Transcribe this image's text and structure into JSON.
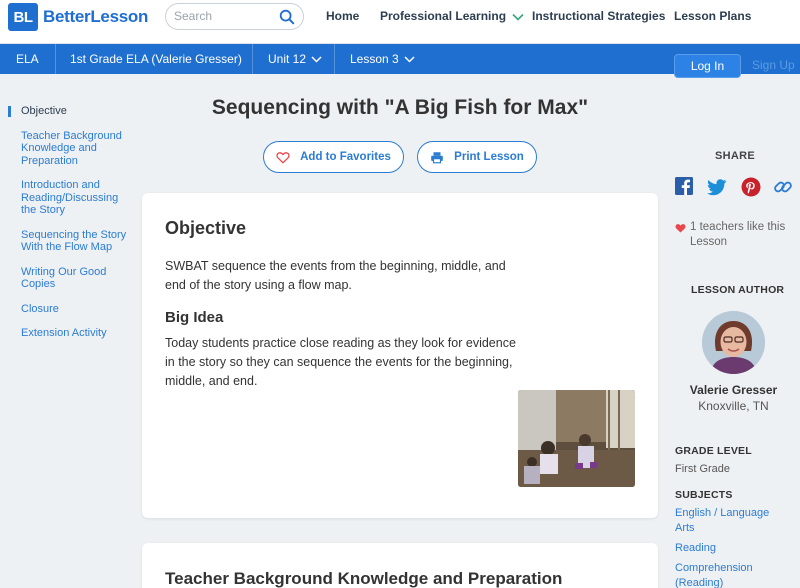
{
  "header": {
    "logo_badge": "BL",
    "logo_text": "BetterLesson",
    "search_placeholder": "Search",
    "nav": [
      "Home",
      "Professional Learning",
      "Instructional Strategies",
      "Lesson Plans"
    ]
  },
  "breadcrumb": {
    "subject": "ELA",
    "course": "1st Grade ELA (Valerie Gresser)",
    "unit": "Unit 12",
    "lesson": "Lesson 3"
  },
  "auth": {
    "login": "Log In",
    "signup": "Sign Up"
  },
  "toc": [
    "Objective",
    "Teacher Background Knowledge and Preparation",
    "Introduction and Reading/Discussing the Story",
    "Sequencing the Story With the Flow Map",
    "Writing Our Good Copies",
    "Closure",
    "Extension Activity"
  ],
  "lesson": {
    "title": "Sequencing with \"A Big Fish for Max\"",
    "add_favorites": "Add to Favorites",
    "print": "Print Lesson"
  },
  "objective_card": {
    "heading": "Objective",
    "objective_text": "SWBAT sequence the events from the beginning, middle, and end of the story using a flow map.",
    "big_idea_heading": "Big Idea",
    "big_idea_text": "Today students practice close reading as they look for evidence in the story so they can sequence the events for the beginning, middle, and end."
  },
  "next_section_heading": "Teacher Background Knowledge and Preparation",
  "sidebar": {
    "share_label": "SHARE",
    "share_icons": [
      "facebook-icon",
      "twitter-icon",
      "pinterest-icon",
      "link-icon"
    ],
    "likes_text": "1 teachers like this Lesson",
    "author_label": "LESSON AUTHOR",
    "author_name": "Valerie Gresser",
    "author_location": "Knoxville, TN",
    "grade_label": "GRADE LEVEL",
    "grade_value": "First Grade",
    "subjects_label": "SUBJECTS",
    "subjects": [
      "English / Language Arts",
      "Reading",
      "Comprehension (Reading)"
    ]
  },
  "colors": {
    "brand": "#1f6fd1",
    "link": "#2b7cd3",
    "heart": "#e8474e"
  }
}
